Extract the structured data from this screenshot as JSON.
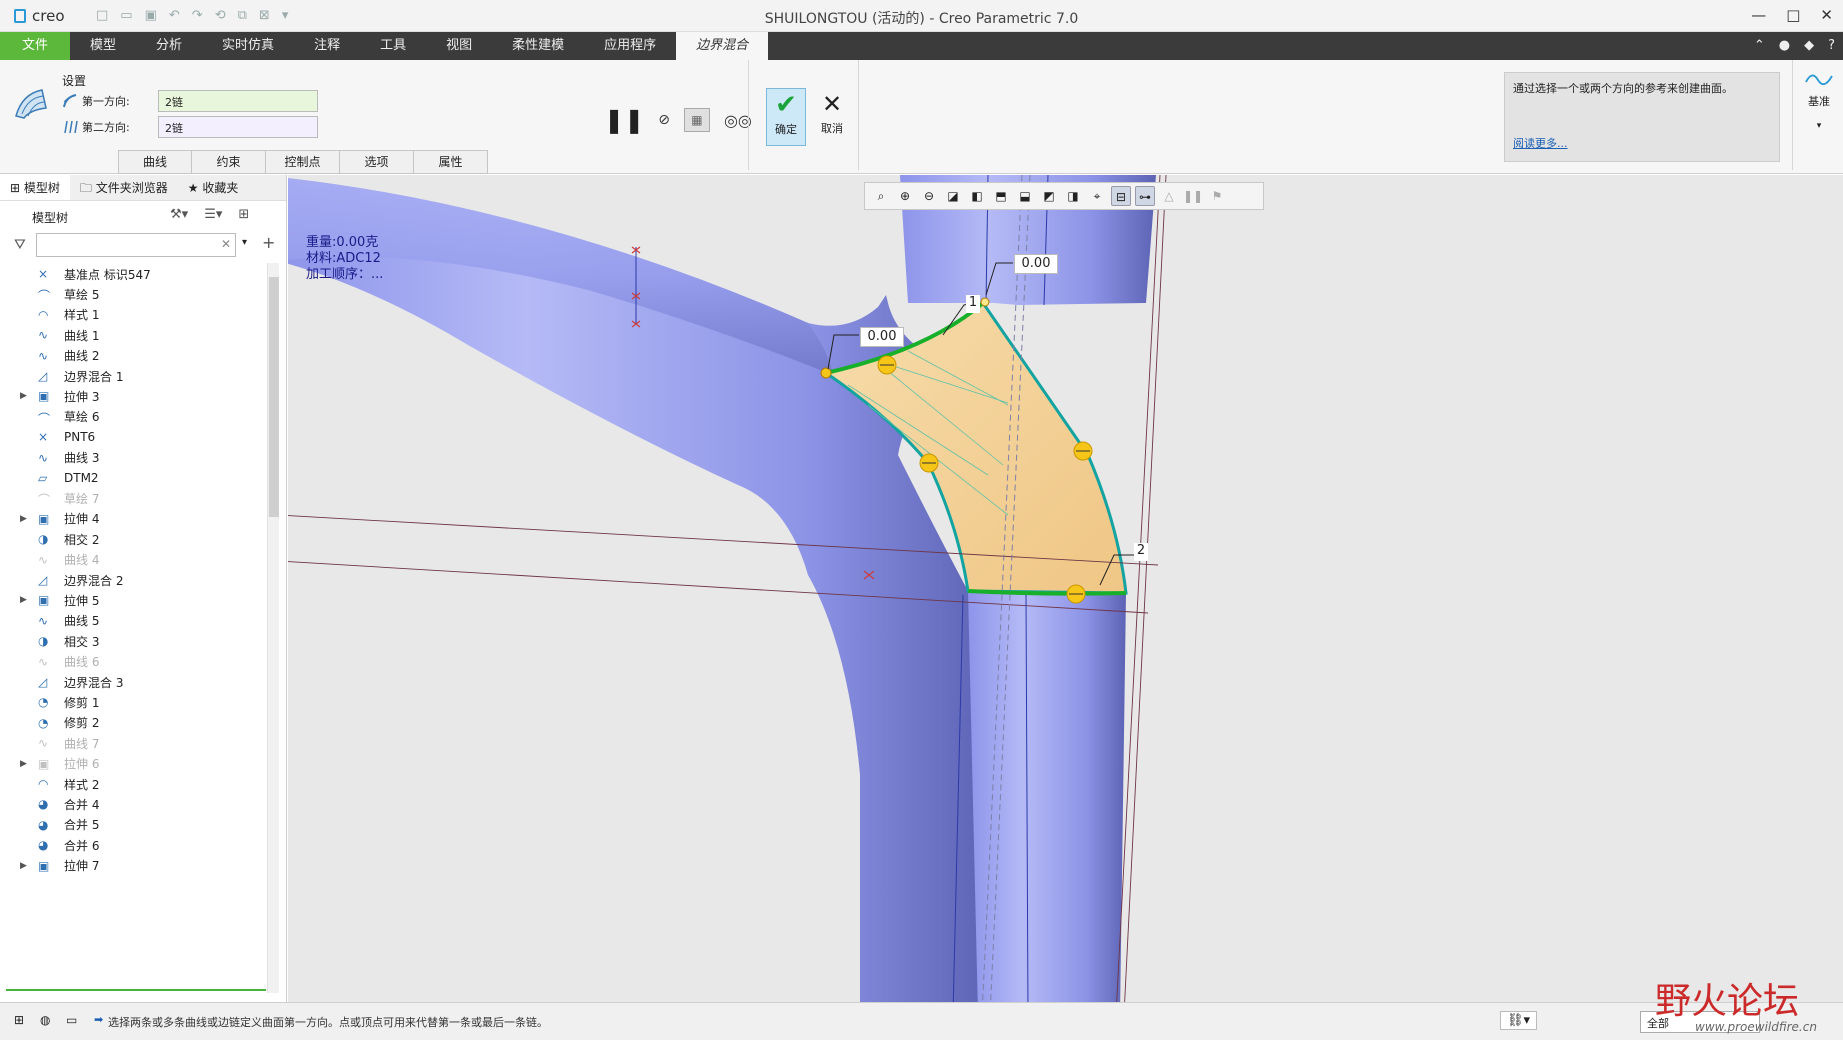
{
  "app": {
    "logo": "creo",
    "title": "SHUILONGTOU (活动的) - Creo Parametric 7.0"
  },
  "ribbon_tabs": [
    "文件",
    "模型",
    "分析",
    "实时仿真",
    "注释",
    "工具",
    "视图",
    "柔性建模",
    "应用程序",
    "边界混合"
  ],
  "ribbon": {
    "settings_label": "设置",
    "dir1_label": "第一方向:",
    "dir1_value": "2链",
    "dir2_label": "第二方向:",
    "dir2_value": "2链",
    "subtabs": [
      "曲线",
      "约束",
      "控制点",
      "选项",
      "属性"
    ],
    "ok_label": "确定",
    "cancel_label": "取消",
    "help_text": "通过选择一个或两个方向的参考来创建曲面。",
    "help_link": "阅读更多...",
    "datum_label": "基准"
  },
  "nav_tabs": [
    "模型树",
    "文件夹浏览器",
    "收藏夹"
  ],
  "tree": {
    "header": "模型树",
    "items": [
      {
        "label": "基准点 标识547",
        "icon": "datum-point-icon",
        "dim": false,
        "expandable": false
      },
      {
        "label": "草绘 5",
        "icon": "sketch-icon",
        "dim": false,
        "expandable": false
      },
      {
        "label": "样式 1",
        "icon": "style-icon",
        "dim": false,
        "expandable": false
      },
      {
        "label": "曲线 1",
        "icon": "curve-icon",
        "dim": false,
        "expandable": false
      },
      {
        "label": "曲线 2",
        "icon": "curve-icon",
        "dim": false,
        "expandable": false
      },
      {
        "label": "边界混合 1",
        "icon": "boundary-blend-icon",
        "dim": false,
        "expandable": false
      },
      {
        "label": "拉伸 3",
        "icon": "extrude-icon",
        "dim": false,
        "expandable": true
      },
      {
        "label": "草绘 6",
        "icon": "sketch-icon",
        "dim": false,
        "expandable": false
      },
      {
        "label": "PNT6",
        "icon": "datum-point-icon",
        "dim": false,
        "expandable": false
      },
      {
        "label": "曲线 3",
        "icon": "curve-icon",
        "dim": false,
        "expandable": false
      },
      {
        "label": "DTM2",
        "icon": "datum-plane-icon",
        "dim": false,
        "expandable": false
      },
      {
        "label": "草绘 7",
        "icon": "sketch-icon",
        "dim": true,
        "expandable": false
      },
      {
        "label": "拉伸 4",
        "icon": "extrude-icon",
        "dim": false,
        "expandable": true
      },
      {
        "label": "相交 2",
        "icon": "intersect-icon",
        "dim": false,
        "expandable": false
      },
      {
        "label": "曲线 4",
        "icon": "curve-icon",
        "dim": true,
        "expandable": false
      },
      {
        "label": "边界混合 2",
        "icon": "boundary-blend-icon",
        "dim": false,
        "expandable": false
      },
      {
        "label": "拉伸 5",
        "icon": "extrude-icon",
        "dim": false,
        "expandable": true
      },
      {
        "label": "曲线 5",
        "icon": "curve-icon",
        "dim": false,
        "expandable": false
      },
      {
        "label": "相交 3",
        "icon": "intersect-icon",
        "dim": false,
        "expandable": false
      },
      {
        "label": "曲线 6",
        "icon": "curve-icon",
        "dim": true,
        "expandable": false
      },
      {
        "label": "边界混合 3",
        "icon": "boundary-blend-icon",
        "dim": false,
        "expandable": false
      },
      {
        "label": "修剪 1",
        "icon": "trim-icon",
        "dim": false,
        "expandable": false
      },
      {
        "label": "修剪 2",
        "icon": "trim-icon",
        "dim": false,
        "expandable": false
      },
      {
        "label": "曲线 7",
        "icon": "curve-icon",
        "dim": true,
        "expandable": false
      },
      {
        "label": "拉伸 6",
        "icon": "extrude-icon",
        "dim": true,
        "expandable": true
      },
      {
        "label": "样式 2",
        "icon": "style-icon",
        "dim": false,
        "expandable": false
      },
      {
        "label": "合并 4",
        "icon": "merge-icon",
        "dim": false,
        "expandable": false
      },
      {
        "label": "合并 5",
        "icon": "merge-icon",
        "dim": false,
        "expandable": false
      },
      {
        "label": "合并 6",
        "icon": "merge-icon",
        "dim": false,
        "expandable": false
      },
      {
        "label": "拉伸 7",
        "icon": "extrude-icon",
        "dim": false,
        "expandable": true
      }
    ]
  },
  "graphics": {
    "mass_info": [
      "重量:0.00克",
      "材料:ADC12",
      "加工顺序：..."
    ],
    "dim1": "0.00",
    "dim2": "0.00",
    "label1": "1",
    "label2": "2"
  },
  "status": {
    "message": "选择两条或多条曲线或边链定义曲面第一方向。点或顶点可用来代替第一条或最后一条链。",
    "filter": "全部"
  },
  "watermark": {
    "text": "野火论坛",
    "url": "www.proewildfire.cn"
  },
  "colors": {
    "accent_green": "#5cb83a",
    "surface_blue": "#8e96e8",
    "blend_fill": "#f2cf92",
    "chain_green": "#18b02a",
    "edge_teal": "#13a3a0",
    "handle_yellow": "#f5c518"
  }
}
